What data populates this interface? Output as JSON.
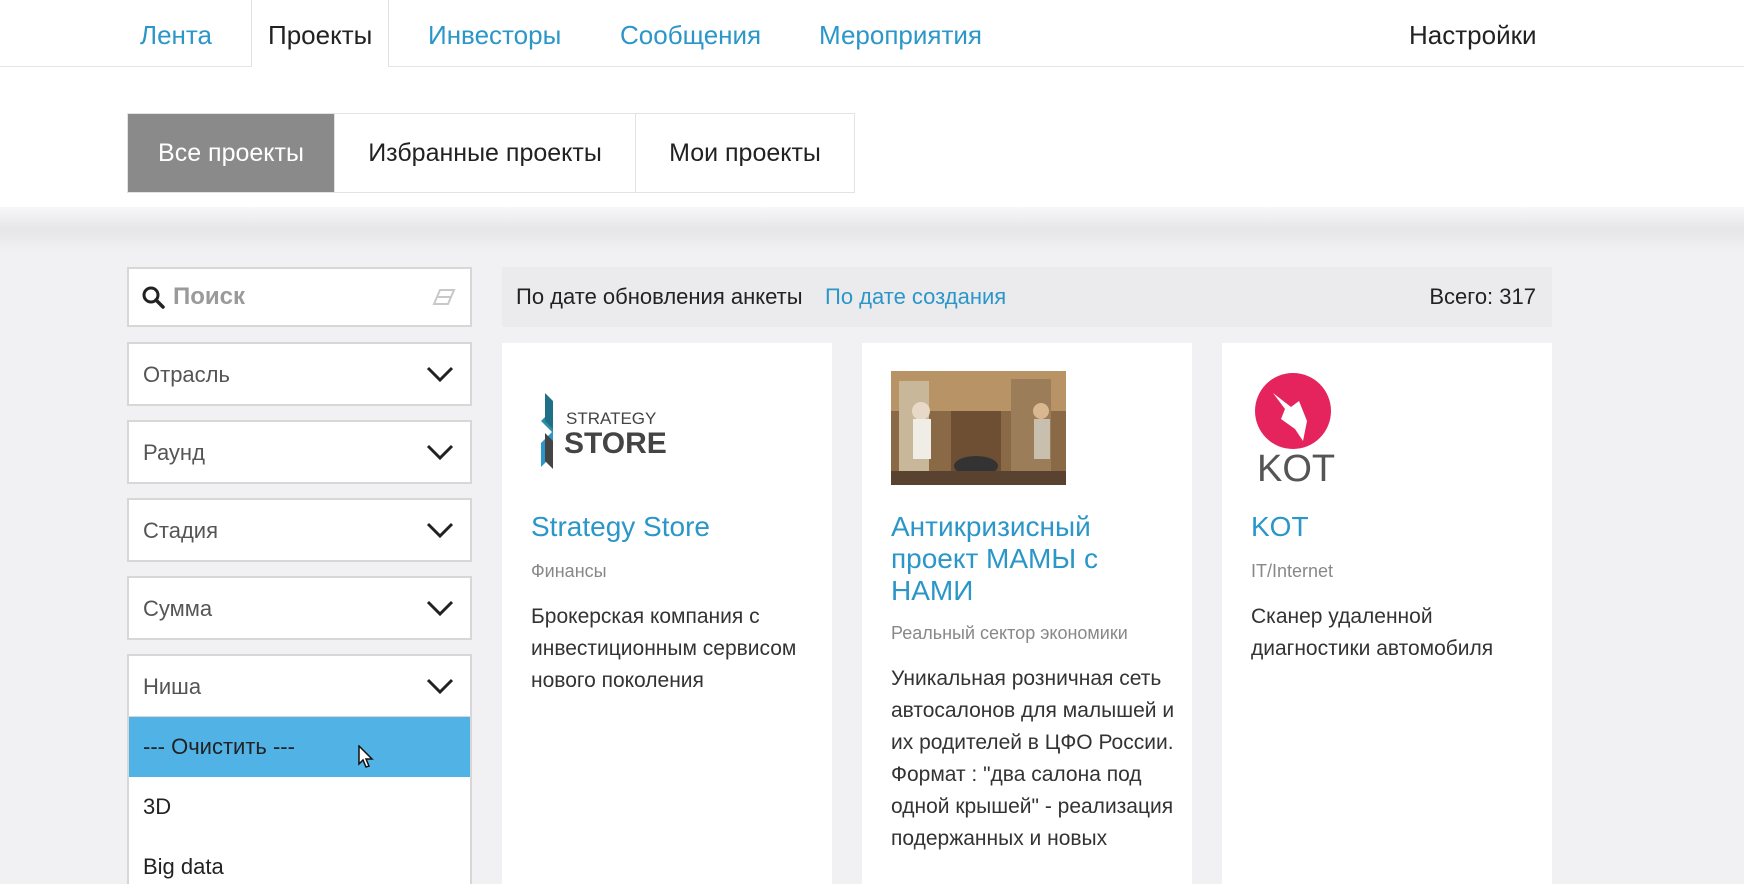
{
  "nav": {
    "tabs": [
      "Лента",
      "Проекты",
      "Инвесторы",
      "Сообщения",
      "Мероприятия"
    ],
    "active_tab": "Проекты",
    "settings": "Настройки"
  },
  "subtabs": [
    "Все проекты",
    "Избранные проекты",
    "Мои проекты"
  ],
  "search": {
    "placeholder": "Поиск"
  },
  "filters": [
    "Отрасль",
    "Раунд",
    "Стадия",
    "Сумма",
    "Ниша"
  ],
  "niche_dropdown": [
    "--- Очистить ---",
    "3D",
    "Big data"
  ],
  "sort": {
    "by_update": "По дате обновления анкеты",
    "by_created": "По дате создания",
    "total": "Всего: 317"
  },
  "cards": [
    {
      "title": "Strategy Store",
      "category": "Финансы",
      "description": "Брокерская компания с инвестиционным сервисом нового поколения",
      "logo_text": [
        "STRATEGY",
        "STORE"
      ]
    },
    {
      "title": "Антикризисный проект МАМЫ с НАМИ",
      "category": "Реальный сектор экономики",
      "description": "Уникальная розничная сеть автосалонов для малышей и их родителей в ЦФО России. Формат : \"два салона под одной крышей\" - реализация подержанных и новых"
    },
    {
      "title": "KOT",
      "category": "IT/Internet",
      "description": "Сканер удаленной диагностики автомобиля",
      "logo_text": "KOT"
    }
  ],
  "colors": {
    "link": "#2b96c8",
    "highlight": "#51b2e6",
    "active_subtab": "#8a8a8a",
    "kot_pink": "#e5245d"
  }
}
